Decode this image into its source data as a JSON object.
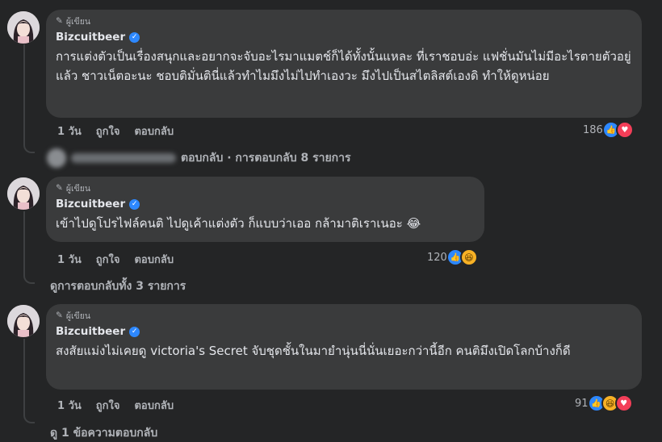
{
  "comments": [
    {
      "badge": "ผู้เขียน",
      "author": "Bizcuitbeer",
      "text": "การแต่งตัวเป็นเรื่องสนุกและอยากจะจับอะไรมาแมตช์ก็ได้ทั้งนั้นแหละ ที่เราชอบอ่ะ แฟชั่นมันไม่มีอะไรตายตัวอยู่แล้ว ชาวเน็ตอะนะ ชอบติมั่นตินี่แล้วทำไมมึงไม่ไปทำเองวะ มึงไปเป็นสไตลิสต์เองดิ ทำให้ดูหน่อย",
      "time": "1 วัน",
      "like": "ถูกใจ",
      "reply": "ตอบกลับ",
      "reaction_count": "186",
      "reactions": [
        "like-icon",
        "love-icon"
      ],
      "replies_link": "ตอบกลับ · การตอบกลับ 8 รายการ"
    },
    {
      "badge": "ผู้เขียน",
      "author": "Bizcuitbeer",
      "text": "เข้าไปดูโปรไฟล์คนติ ไปดูเค้าแต่งตัว ก็แบบว่าเออ กล้ามาติเราเนอะ 😂",
      "time": "1 วัน",
      "like": "ถูกใจ",
      "reply": "ตอบกลับ",
      "reaction_count": "120",
      "reactions": [
        "like-icon",
        "haha-icon"
      ],
      "replies_link": "ดูการตอบกลับทั้ง 3 รายการ"
    },
    {
      "badge": "ผู้เขียน",
      "author": "Bizcuitbeer",
      "text": "สงสัยแม่งไม่เคยดู victoria's Secret จับชุดชั้นในมายำนุ่นนี่นั่นเยอะกว่านี้อีก คนติมึงเปิดโลกบ้างก็ดี",
      "time": "1 วัน",
      "like": "ถูกใจ",
      "reply": "ตอบกลับ",
      "reaction_count": "91",
      "reactions": [
        "like-icon",
        "haha-icon",
        "love-icon"
      ],
      "replies_link": "ดู 1 ข้อความตอบกลับ"
    }
  ],
  "colors": {
    "background": "#242526",
    "bubble": "#3a3b3c",
    "like": "#2d88ff",
    "love": "#f33e58",
    "haha": "#f7b125"
  }
}
